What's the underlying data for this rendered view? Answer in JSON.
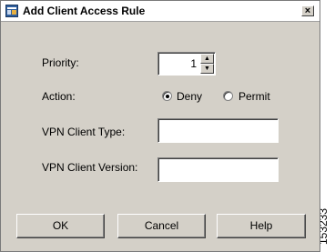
{
  "window": {
    "title": "Add Client Access Rule",
    "close_glyph": "×",
    "icon": "app-icon"
  },
  "form": {
    "priority": {
      "label": "Priority:",
      "value": "1"
    },
    "action": {
      "label": "Action:",
      "options": [
        {
          "label": "Deny",
          "selected": true
        },
        {
          "label": "Permit",
          "selected": false
        }
      ]
    },
    "vpn_client_type": {
      "label": "VPN Client Type:",
      "value": ""
    },
    "vpn_client_version": {
      "label": "VPN Client Version:",
      "value": ""
    }
  },
  "buttons": {
    "ok": "OK",
    "cancel": "Cancel",
    "help": "Help"
  },
  "figure_id": "153233"
}
